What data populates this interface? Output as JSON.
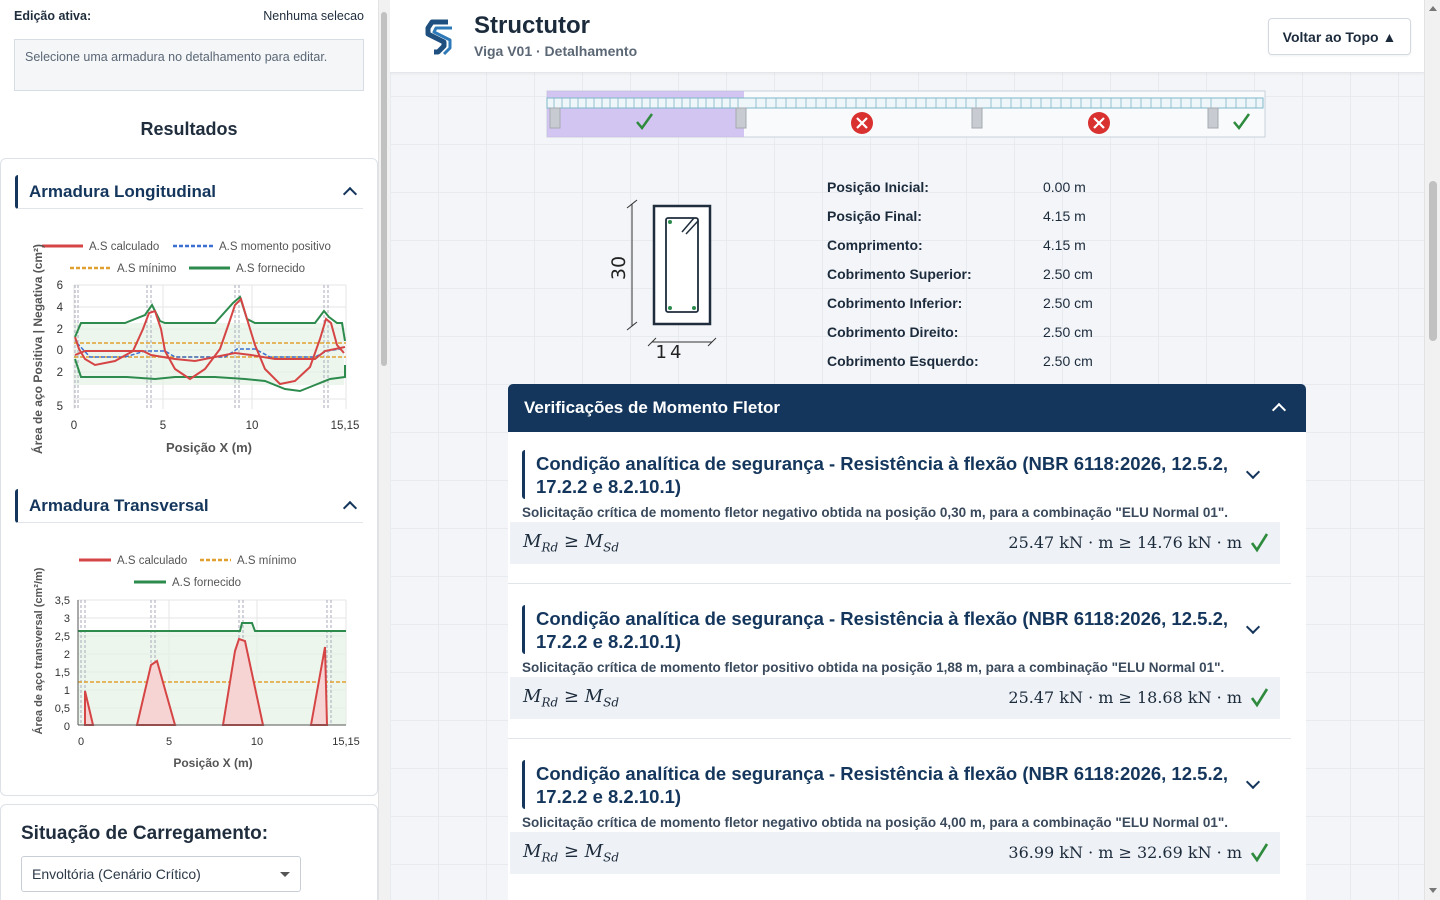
{
  "left_panel": {
    "edit_label": "Edição ativa:",
    "edit_value": "Nenhuma selecao",
    "info_text": "Selecione uma armadura no detalhamento para editar.",
    "results_title": "Resultados",
    "longitudinal": {
      "title": "Armadura Longitudinal",
      "legend": [
        "A.S calculado",
        "A.S momento positivo",
        "A.S mínimo",
        "A.S fornecido"
      ],
      "ylabel": "Área de aço Positiva | Negativa (cm²)",
      "xlabel": "Posição X (m)",
      "yticks": [
        "6",
        "4",
        "2",
        "0",
        "2",
        "5"
      ],
      "xticks": [
        "0",
        "5",
        "10",
        "15,15"
      ]
    },
    "transversal": {
      "title": "Armadura Transversal",
      "legend": [
        "A.S calculado",
        "A.S mínimo",
        "A.S fornecido"
      ],
      "ylabel": "Área de aço transversal (cm²/m)",
      "xlabel": "Posição X (m)",
      "yticks": [
        "3,5",
        "3",
        "2,5",
        "2",
        "1,5",
        "1",
        "0,5",
        "0"
      ],
      "xticks": [
        "0",
        "5",
        "10",
        "15,15"
      ]
    },
    "loading": {
      "title": "Situação de Carregamento:",
      "selected": "Envoltória (Cenário Crítico)"
    }
  },
  "header": {
    "app_title": "Structutor",
    "subtitle": "Viga V01 · Detalhamento",
    "back_to_top": "Voltar ao Topo ▲"
  },
  "section": {
    "height_label": "30",
    "width_label": "14"
  },
  "properties": [
    {
      "label": "Posição Inicial:",
      "value": "0.00 m"
    },
    {
      "label": "Posição Final:",
      "value": "4.15 m"
    },
    {
      "label": "Comprimento:",
      "value": "4.15 m"
    },
    {
      "label": "Cobrimento Superior:",
      "value": "2.50 cm"
    },
    {
      "label": "Cobrimento Inferior:",
      "value": "2.50 cm"
    },
    {
      "label": "Cobrimento Direito:",
      "value": "2.50 cm"
    },
    {
      "label": "Cobrimento Esquerdo:",
      "value": "2.50 cm"
    }
  ],
  "spans_status": [
    "ok",
    "fail",
    "fail",
    "ok"
  ],
  "verifications": {
    "title": "Verificações de Momento Fletor",
    "items": [
      {
        "title": "Condição analítica de segurança - Resistência à flexão (NBR 6118:2026, 12.5.2, 17.2.2 e 8.2.10.1)",
        "description": "Solicitação crítica de momento fletor negativo obtida na posição 0,30 m, para a combinação \"ELU Normal 01\".",
        "lhs_main": "M",
        "lhs_sub1": "Rd",
        "lhs_op": " ≥ M",
        "lhs_sub2": "Sd",
        "rhs": "25.47 kN · m ≥ 14.76 kN · m"
      },
      {
        "title": "Condição analítica de segurança - Resistência à flexão (NBR 6118:2026, 12.5.2, 17.2.2 e 8.2.10.1)",
        "description": "Solicitação crítica de momento fletor positivo obtida na posição 1,88 m, para a combinação \"ELU Normal 01\".",
        "lhs_main": "M",
        "lhs_sub1": "Rd",
        "lhs_op": " ≥ M",
        "lhs_sub2": "Sd",
        "rhs": "25.47 kN · m ≥ 18.68 kN · m"
      },
      {
        "title": "Condição analítica de segurança - Resistência à flexão (NBR 6118:2026, 12.5.2, 17.2.2 e 8.2.10.1)",
        "description": "Solicitação crítica de momento fletor negativo obtida na posição 4,00 m, para a combinação \"ELU Normal 01\".",
        "lhs_main": "M",
        "lhs_sub1": "Rd",
        "lhs_op": " ≥ M",
        "lhs_sub2": "Sd",
        "rhs": "36.99 kN · m ≥ 32.69 kN · m"
      }
    ]
  },
  "colors": {
    "primary": "#14365c",
    "calculated": "#d64545",
    "positive": "#3b6fd1",
    "minimum": "#e0a030",
    "provided": "#2e8b4e",
    "ok": "#2e8b3e",
    "fail": "#d93030"
  }
}
